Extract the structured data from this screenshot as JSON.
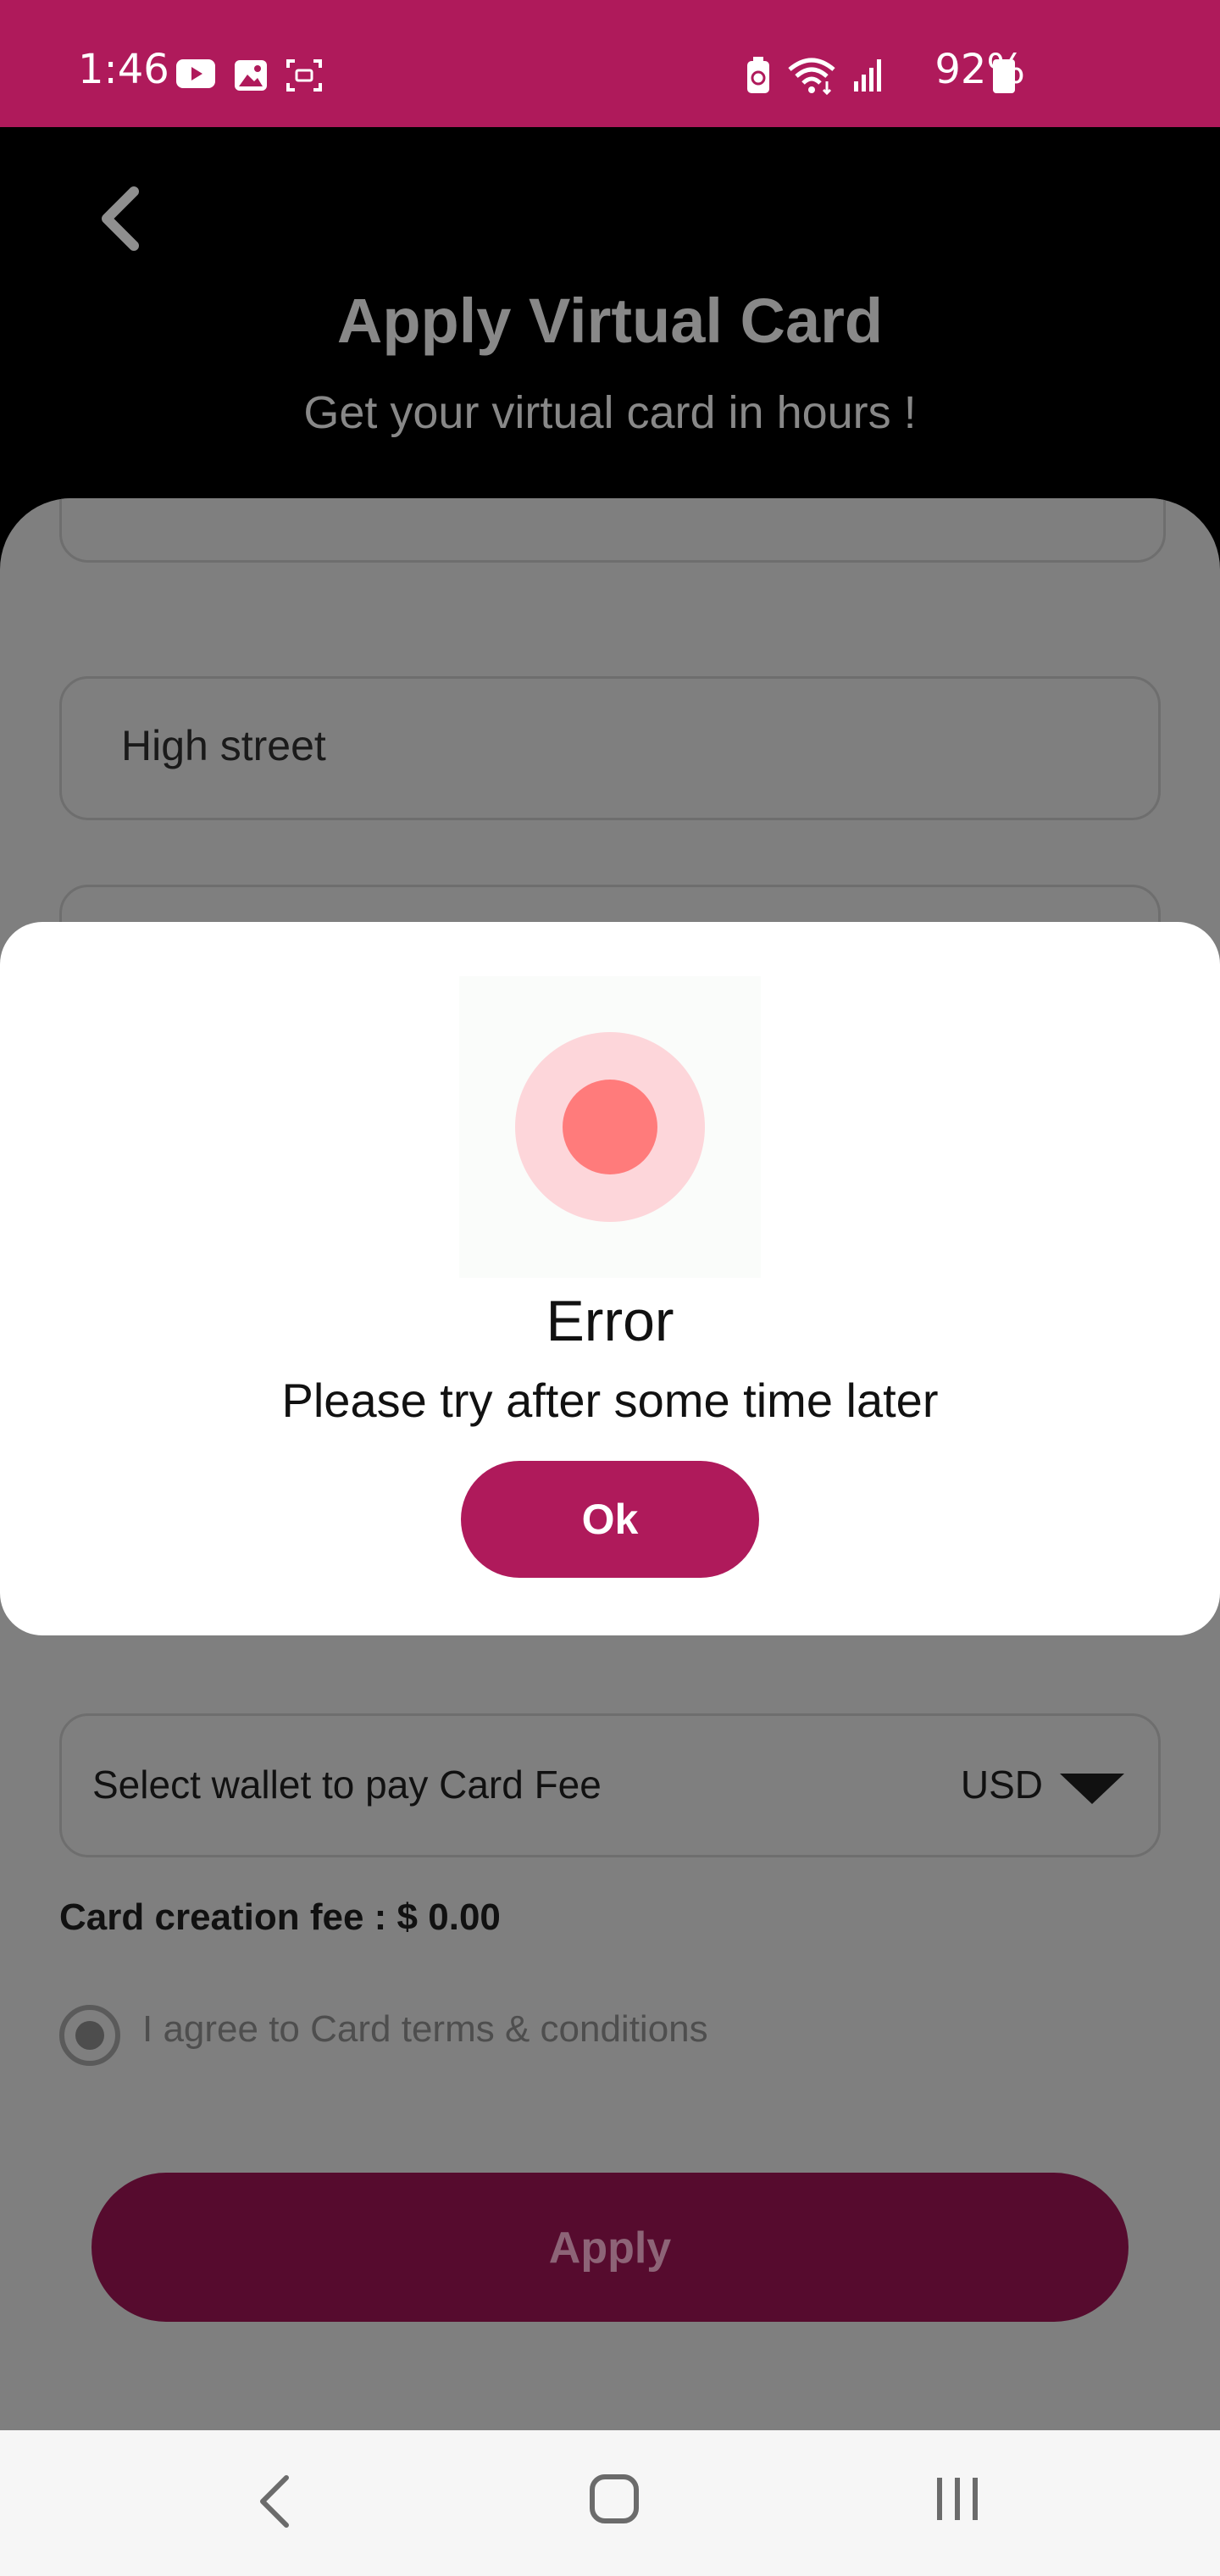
{
  "status_bar": {
    "time": "1:46",
    "battery_percent": "92%",
    "left_icons": [
      "youtube-icon",
      "image-icon",
      "screenshot-icon"
    ],
    "right_icons": [
      "battery-saver-icon",
      "wifi-icon",
      "signal-icon",
      "battery-icon"
    ],
    "color": "#af1a5b"
  },
  "header": {
    "title": "Apply Virtual Card",
    "subtitle": "Get your virtual card in hours !"
  },
  "form": {
    "address_field_value": "High street",
    "wallet_label": "Select wallet to pay Card Fee",
    "wallet_currency": "USD",
    "fee_text": "Card creation fee : $ 0.00",
    "agree_text": "I agree to Card terms & conditions",
    "apply_label": "Apply"
  },
  "modal": {
    "title": "Error",
    "message": "Please try after some time later",
    "ok_label": "Ok",
    "accent": "#af1a5b",
    "icon": "error-dot-icon"
  },
  "nav_bar": {
    "icons": [
      "nav-back-icon",
      "nav-home-icon",
      "nav-recents-icon"
    ]
  }
}
